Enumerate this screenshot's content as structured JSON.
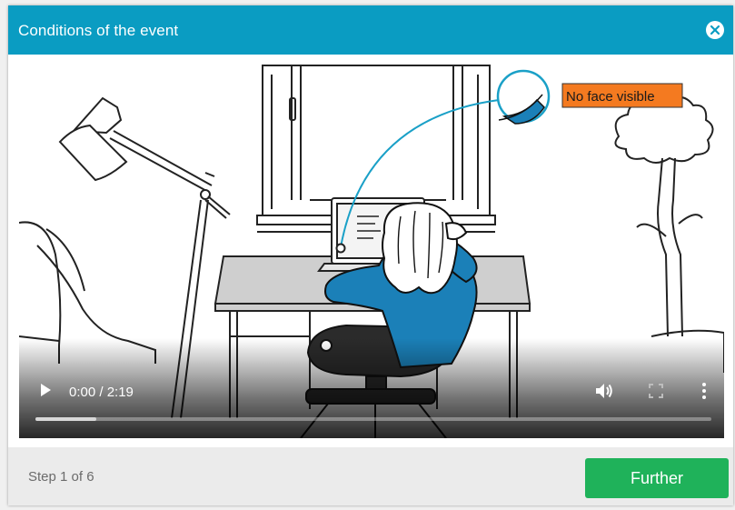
{
  "dialog": {
    "title": "Conditions of the event",
    "close_icon": "close-circle-icon"
  },
  "video": {
    "annotation_label": "No face visible",
    "annotation_color": "#f47a20",
    "accent_color": "#1aa0c7",
    "sweater_color": "#1b80b8",
    "time_display": "0:00 / 2:19",
    "progress_fraction": 0.09,
    "icons": {
      "play": "play-icon",
      "volume": "volume-icon",
      "fullscreen": "fullscreen-icon",
      "more": "more-options-icon"
    }
  },
  "footer": {
    "step_text": "Step 1 of 6",
    "next_label": "Further",
    "next_color": "#1fb25a"
  }
}
